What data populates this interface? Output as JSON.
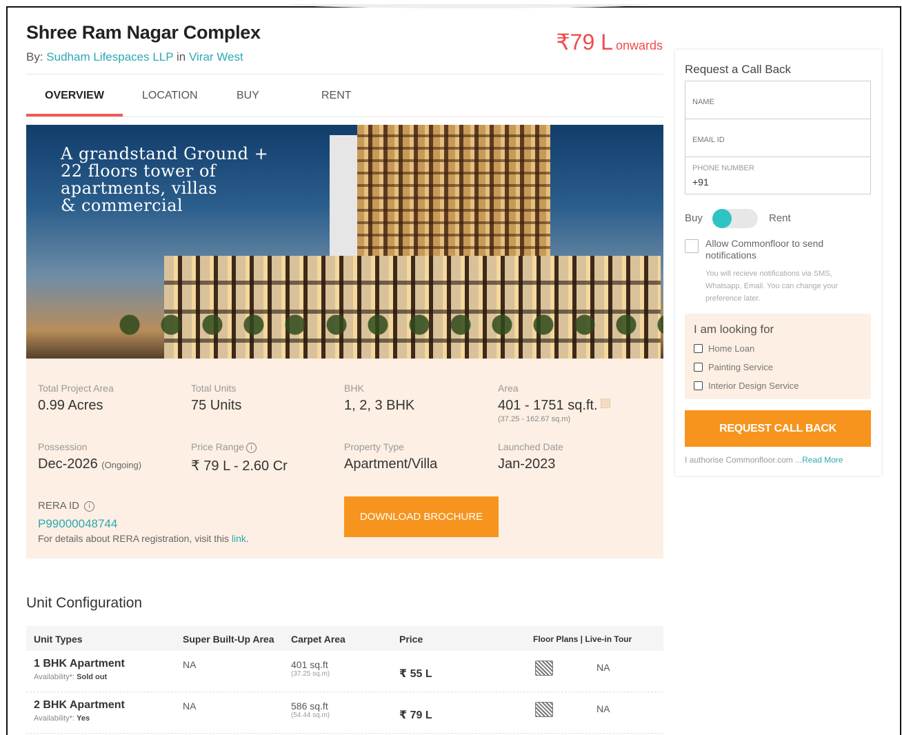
{
  "project": {
    "title": "Shree Ram Nagar Complex",
    "by_label": "By:",
    "developer": "Sudham Lifespaces LLP",
    "in_label": "in",
    "locality": "Virar West",
    "price": "₹79 L",
    "price_suffix": "onwards"
  },
  "tabs": [
    {
      "label": "OVERVIEW",
      "active": true
    },
    {
      "label": "LOCATION",
      "active": false
    },
    {
      "label": "BUY",
      "active": false
    },
    {
      "label": "RENT",
      "active": false
    }
  ],
  "hero": {
    "line1": "A grandstand Ground +",
    "line2": "22 floors tower of",
    "line3": "apartments, villas",
    "line4": "& commercial"
  },
  "facts": {
    "total_area": {
      "label": "Total Project Area",
      "value": "0.99 Acres"
    },
    "total_units": {
      "label": "Total Units",
      "value": "75 Units"
    },
    "bhk": {
      "label": "BHK",
      "value": "1, 2, 3 BHK"
    },
    "area": {
      "label": "Area",
      "value": "401 - 1751 sq.ft.",
      "sub": "(37.25 - 162.67 sq.m)"
    },
    "possession": {
      "label": "Possession",
      "value": "Dec-2026",
      "tag": "(Ongoing)"
    },
    "price_range": {
      "label": "Price Range",
      "value": "₹ 79 L - 2.60 Cr"
    },
    "property_type": {
      "label": "Property Type",
      "value": "Apartment/Villa"
    },
    "launched": {
      "label": "Launched Date",
      "value": "Jan-2023"
    },
    "rera_label": "RERA ID",
    "rera_id": "P99000048744",
    "rera_note": "For details about RERA registration, visit this",
    "rera_link": "link",
    "brochure_button": "DOWNLOAD BROCHURE"
  },
  "unit_config": {
    "title": "Unit Configuration",
    "headers": [
      "Unit Types",
      "Super Built-Up Area",
      "Carpet Area",
      "Price",
      "Floor Plans | Live-in Tour"
    ],
    "rows": [
      {
        "type": "1 BHK Apartment",
        "availability_label": "Availability*:",
        "availability": "Sold out",
        "super_area": "NA",
        "carpet": "401 sq.ft",
        "carpet_sub": "(37.25 sq.m)",
        "price": "₹ 55 L",
        "tour": "NA"
      },
      {
        "type": "2 BHK Apartment",
        "availability_label": "Availability*:",
        "availability": "Yes",
        "super_area": "NA",
        "carpet": "586 sq.ft",
        "carpet_sub": "(54.44 sq.m)",
        "price": "₹ 79 L",
        "tour": "NA"
      }
    ]
  },
  "callback": {
    "title": "Request a Call Back",
    "name_placeholder": "NAME",
    "email_placeholder": "EMAIL ID",
    "phone_label": "PHONE NUMBER",
    "phone_prefix": "+91",
    "toggle_left": "Buy",
    "toggle_right": "Rent",
    "allow_text": "Allow Commonfloor to send notifications",
    "allow_note": "You will recieve notifications via SMS, Whatsapp, Email. You can change your preference later.",
    "looking_title": "I am looking for",
    "looking_options": [
      "Home Loan",
      "Painting Service",
      "Interior Design Service"
    ],
    "button": "REQUEST CALL BACK",
    "authorise": "I authorise Commonfloor.com ...",
    "read_more": "Read More"
  },
  "colors": {
    "accent_orange": "#f7941d",
    "price_red": "#ee4c4c",
    "link_teal": "#2aa9b3",
    "panel_peach": "#fdefe3"
  }
}
